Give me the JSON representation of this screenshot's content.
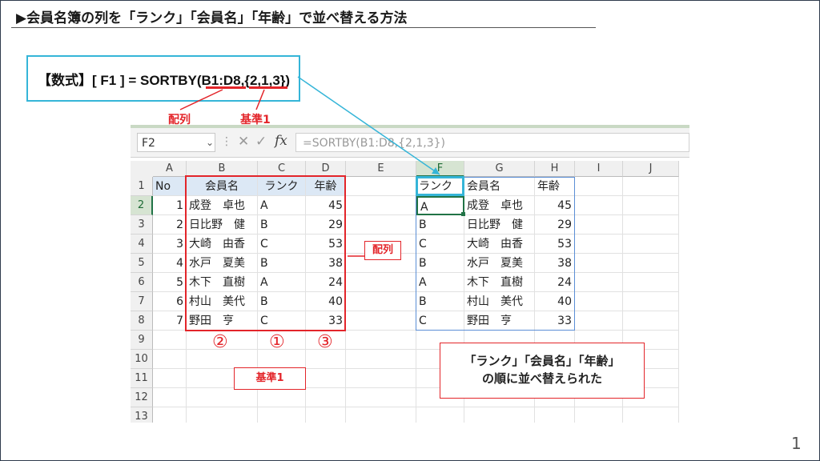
{
  "title": "▶会員名簿の列を「ランク」「会員名」「年齢」で並べ替える方法",
  "formula": {
    "prefix": "【数式】[ F1 ] = SORTBY(",
    "arg1": "B1:D8",
    "comma": ",",
    "arg2": "{2,1,3}",
    "suffix": ")"
  },
  "labels": {
    "array": "配列",
    "criteria": "基準1",
    "array_tag": "配列",
    "criteria_tag": "基準1"
  },
  "circles": [
    "②",
    "①",
    "③"
  ],
  "note_lines": [
    "「ランク」「会員名」「年齢」",
    "の順に並べ替えられた"
  ],
  "slide_number": "1",
  "excel": {
    "name_box": "F2",
    "formula_bar": "=SORTBY(B1:D8,{2,1,3})",
    "columns": [
      "A",
      "B",
      "C",
      "D",
      "E",
      "F",
      "G",
      "H",
      "I",
      "J"
    ],
    "rows": [
      "1",
      "2",
      "3",
      "4",
      "5",
      "6",
      "7",
      "8",
      "9",
      "10",
      "11",
      "12",
      "13"
    ],
    "source_header": [
      "No",
      "会員名",
      "ランク",
      "年齢"
    ],
    "source_rows": [
      [
        "1",
        "成登　卓也",
        "A",
        "45"
      ],
      [
        "2",
        "日比野　健",
        "B",
        "29"
      ],
      [
        "3",
        "大崎　由香",
        "C",
        "53"
      ],
      [
        "4",
        "水戸　夏美",
        "B",
        "38"
      ],
      [
        "5",
        "木下　直樹",
        "A",
        "24"
      ],
      [
        "6",
        "村山　美代",
        "B",
        "40"
      ],
      [
        "7",
        "野田　亨",
        "C",
        "33"
      ]
    ],
    "result_header": [
      "ランク",
      "会員名",
      "年齢"
    ],
    "result_rows": [
      [
        "A",
        "成登　卓也",
        "45"
      ],
      [
        "B",
        "日比野　健",
        "29"
      ],
      [
        "C",
        "大崎　由香",
        "53"
      ],
      [
        "B",
        "水戸　夏美",
        "38"
      ],
      [
        "A",
        "木下　直樹",
        "24"
      ],
      [
        "B",
        "村山　美代",
        "40"
      ],
      [
        "C",
        "野田　亨",
        "33"
      ]
    ]
  }
}
